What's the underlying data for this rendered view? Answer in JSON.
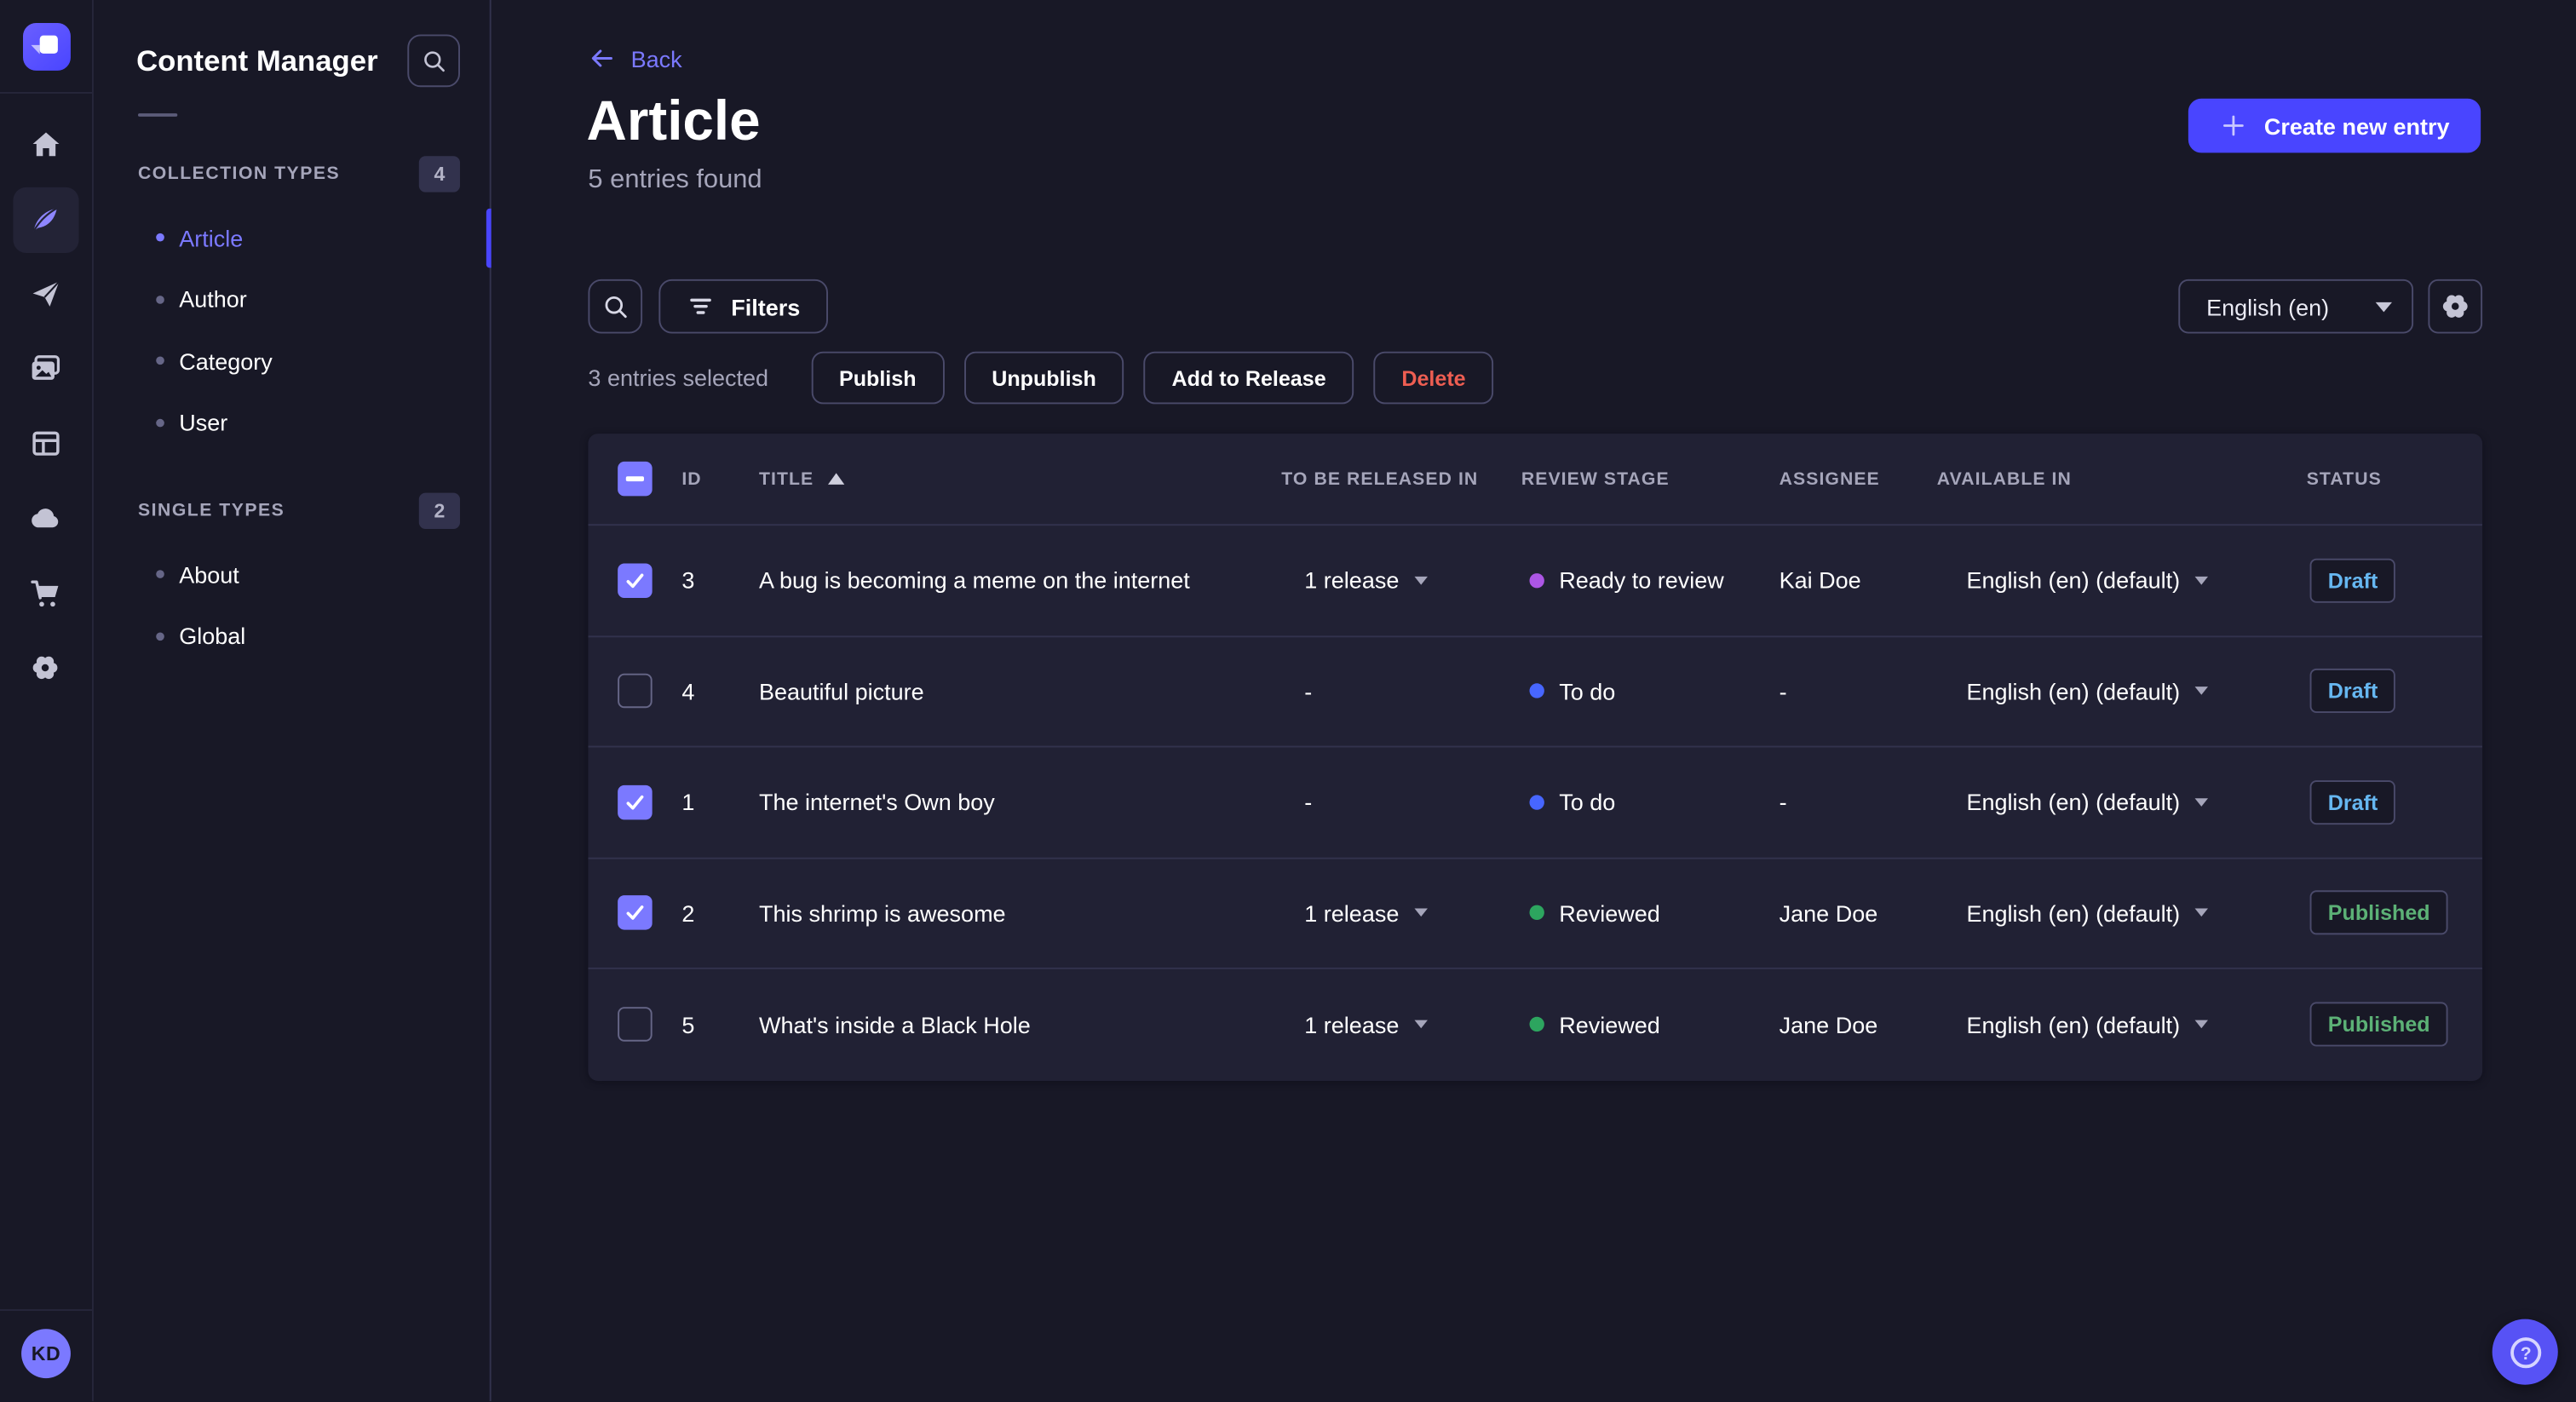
{
  "colors": {
    "background": "#181826",
    "surface": "#212134",
    "border": "#32324d",
    "border_strong": "#4a4a6a",
    "primary": "#4945ff",
    "primary_light": "#7b79ff",
    "text": "#ffffff",
    "text_muted": "#a5a5ba",
    "danger": "#ee5e52",
    "draft": "#66b7f1",
    "published": "#5cb176"
  },
  "rail": {
    "logo_icon": "strapi-logo",
    "items": [
      {
        "icon": "home-icon",
        "active": false
      },
      {
        "icon": "feather-icon",
        "active": true
      },
      {
        "icon": "paper-plane-icon",
        "active": false
      },
      {
        "icon": "media-gallery-icon",
        "active": false
      },
      {
        "icon": "layout-icon",
        "active": false
      },
      {
        "icon": "cloud-icon",
        "active": false
      },
      {
        "icon": "cart-icon",
        "active": false
      },
      {
        "icon": "gear-icon",
        "active": false
      }
    ],
    "avatar_initials": "KD"
  },
  "sidebar": {
    "title": "Content Manager",
    "search_icon": "search-icon",
    "sections": [
      {
        "label": "COLLECTION TYPES",
        "count": "4",
        "items": [
          {
            "label": "Article",
            "active": true
          },
          {
            "label": "Author",
            "active": false
          },
          {
            "label": "Category",
            "active": false
          },
          {
            "label": "User",
            "active": false
          }
        ]
      },
      {
        "label": "SINGLE TYPES",
        "count": "2",
        "items": [
          {
            "label": "About",
            "active": false
          },
          {
            "label": "Global",
            "active": false
          }
        ]
      }
    ]
  },
  "header": {
    "back_label": "Back",
    "title": "Article",
    "subtitle": "5 entries found",
    "create_label": "Create new entry"
  },
  "toolbar": {
    "search_icon": "search-icon",
    "filters_label": "Filters",
    "locale_value": "English (en)",
    "settings_icon": "gear-icon"
  },
  "selection": {
    "summary": "3 entries selected",
    "publish_label": "Publish",
    "unpublish_label": "Unpublish",
    "add_to_release_label": "Add to Release",
    "delete_label": "Delete"
  },
  "table": {
    "columns": {
      "id": "ID",
      "title": "TITLE",
      "release": "TO BE RELEASED IN",
      "stage": "REVIEW STAGE",
      "assignee": "ASSIGNEE",
      "available": "AVAILABLE IN",
      "status": "STATUS"
    },
    "sort": {
      "column": "TITLE",
      "direction": "asc"
    },
    "rows": [
      {
        "checked": true,
        "id": "3",
        "title": "A bug is becoming a meme on the internet",
        "release": "1 release",
        "stage": "Ready to review",
        "stage_color": "#ac56e5",
        "assignee": "Kai Doe",
        "locale": "English (en) (default)",
        "status": "Draft",
        "status_color": "#66b7f1"
      },
      {
        "checked": false,
        "id": "4",
        "title": "Beautiful picture",
        "release": "-",
        "stage": "To do",
        "stage_color": "#4766ff",
        "assignee": "-",
        "locale": "English (en) (default)",
        "status": "Draft",
        "status_color": "#66b7f1"
      },
      {
        "checked": true,
        "id": "1",
        "title": "The internet's Own boy",
        "release": "-",
        "stage": "To do",
        "stage_color": "#4766ff",
        "assignee": "-",
        "locale": "English (en) (default)",
        "status": "Draft",
        "status_color": "#66b7f1"
      },
      {
        "checked": true,
        "id": "2",
        "title": "This shrimp is awesome",
        "release": "1 release",
        "stage": "Reviewed",
        "stage_color": "#2da55f",
        "assignee": "Jane Doe",
        "locale": "English (en) (default)",
        "status": "Published",
        "status_color": "#5cb176"
      },
      {
        "checked": false,
        "id": "5",
        "title": "What's inside a Black Hole",
        "release": "1 release",
        "stage": "Reviewed",
        "stage_color": "#2da55f",
        "assignee": "Jane Doe",
        "locale": "English (en) (default)",
        "status": "Published",
        "status_color": "#5cb176"
      }
    ]
  },
  "help": {
    "icon": "question-mark-icon"
  }
}
